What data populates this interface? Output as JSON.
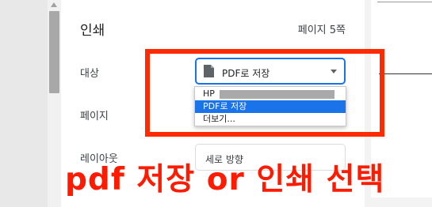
{
  "dialog": {
    "title": "인쇄",
    "page_count": "페이지 5쪽",
    "labels": {
      "destination": "대상",
      "pages": "페이지",
      "layout": "레이아웃"
    },
    "destination": {
      "selected": "PDF로 저장",
      "options": [
        "HP",
        "PDF로 저장",
        "더보기..."
      ]
    },
    "layout": {
      "selected": "세로 방향"
    }
  },
  "annotation": {
    "text": "pdf 저장 or 인쇄 선택",
    "color": "#ff1a00"
  },
  "colors": {
    "accent": "#1a73e8",
    "highlight_border": "#ff2a00"
  }
}
